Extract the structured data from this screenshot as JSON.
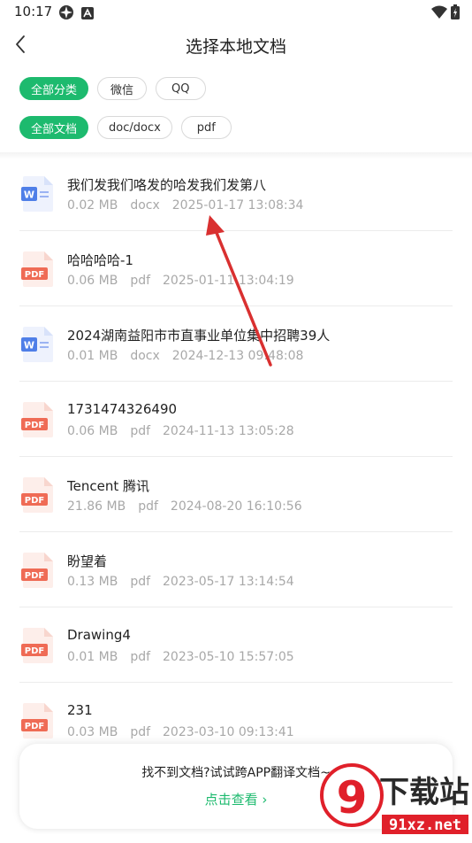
{
  "status_bar": {
    "time": "10:17"
  },
  "header": {
    "title": "选择本地文档"
  },
  "source_filters": [
    {
      "label": "全部分类",
      "active": true
    },
    {
      "label": "微信",
      "active": false
    },
    {
      "label": "QQ",
      "active": false
    }
  ],
  "type_filters": [
    {
      "label": "全部文档",
      "active": true
    },
    {
      "label": "doc/docx",
      "active": false
    },
    {
      "label": "pdf",
      "active": false
    }
  ],
  "files": [
    {
      "name": "我们发我们咯发的哈发我们发第八",
      "size": "0.02 MB",
      "type": "docx",
      "date": "2025-01-17 13:08:34",
      "icon": "word-icon"
    },
    {
      "name": "哈哈哈哈-1",
      "size": "0.06 MB",
      "type": "pdf",
      "date": "2025-01-11 13:04:19",
      "icon": "pdf-icon"
    },
    {
      "name": "2024湖南益阳市市直事业单位集中招聘39人",
      "size": "0.01 MB",
      "type": "docx",
      "date": "2024-12-13 09:48:08",
      "icon": "word-icon"
    },
    {
      "name": "1731474326490",
      "size": "0.06 MB",
      "type": "pdf",
      "date": "2024-11-13 13:05:28",
      "icon": "pdf-icon"
    },
    {
      "name": "Tencent 腾讯",
      "size": "21.86 MB",
      "type": "pdf",
      "date": "2024-08-20 16:10:56",
      "icon": "pdf-icon"
    },
    {
      "name": "盼望着",
      "size": "0.13 MB",
      "type": "pdf",
      "date": "2023-05-17 13:14:54",
      "icon": "pdf-icon"
    },
    {
      "name": "Drawing4",
      "size": "0.01 MB",
      "type": "pdf",
      "date": "2023-05-10 15:57:05",
      "icon": "pdf-icon"
    },
    {
      "name": "231",
      "size": "0.03 MB",
      "type": "pdf",
      "date": "2023-03-10 09:13:41",
      "icon": "pdf-icon"
    }
  ],
  "bottom_card": {
    "message": "找不到文档?试试跨APP翻译文档~",
    "link": "点击查看 ›"
  },
  "colors": {
    "accent": "#1dba6e",
    "pdf": "#ef6b55",
    "word": "#4f7fe8",
    "annotation_arrow": "#d93030"
  },
  "watermark": {
    "main": "下载站",
    "sub": "91xz.net",
    "logo": "9"
  }
}
